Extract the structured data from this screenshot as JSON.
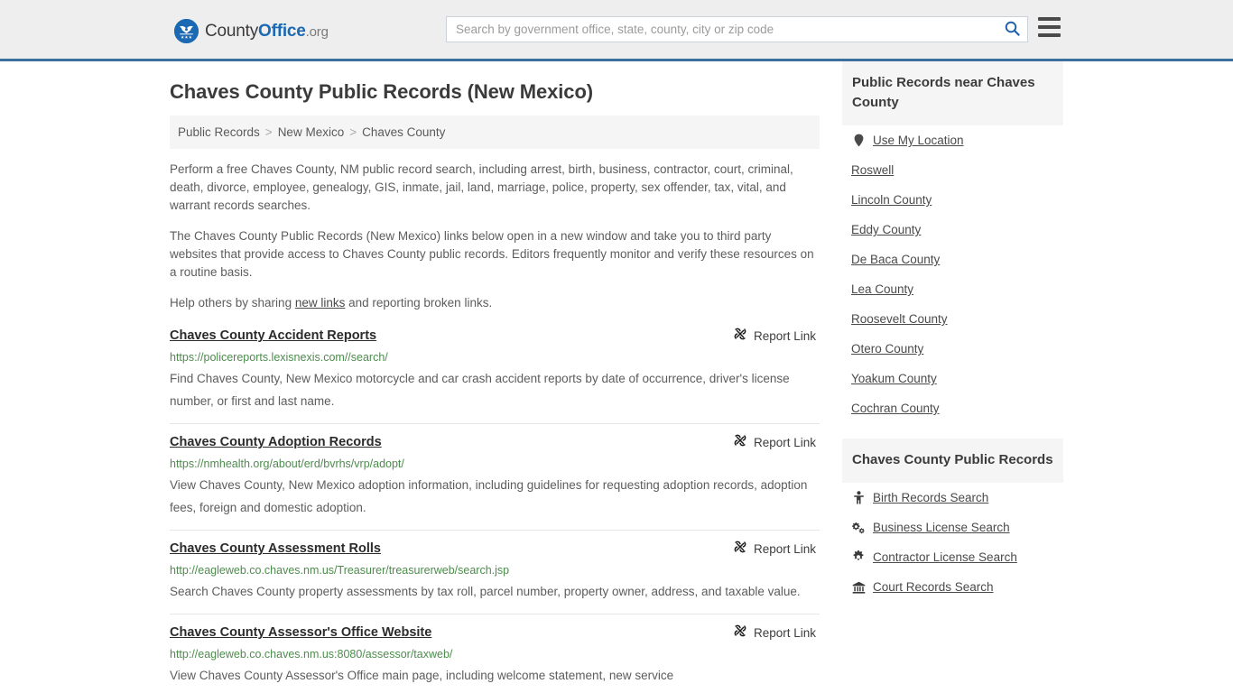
{
  "header": {
    "logo": {
      "icon": "county-office-eagle-emblem",
      "part1": "County",
      "part2": "Office",
      "part3": ".org"
    },
    "search": {
      "placeholder": "Search by government office, state, county, city or zip code",
      "value": "",
      "search_icon": "search-icon"
    },
    "menu_icon": "hamburger-menu-icon"
  },
  "main": {
    "title": "Chaves County Public Records (New Mexico)",
    "breadcrumb": {
      "items": [
        "Public Records",
        "New Mexico",
        "Chaves County"
      ],
      "separator": ">"
    },
    "intro": {
      "p1": "Perform a free Chaves County, NM public record search, including arrest, birth, business, contractor, court, criminal, death, divorce, employee, genealogy, GIS, inmate, jail, land, marriage, police, property, sex offender, tax, vital, and warrant records searches.",
      "p2": "The Chaves County Public Records (New Mexico) links below open in a new window and take you to third party websites that provide access to Chaves County public records. Editors frequently monitor and verify these resources on a routine basis.",
      "p3_before": "Help others by sharing ",
      "p3_link": "new links",
      "p3_after": " and reporting broken links."
    },
    "report_link_label": "Report Link",
    "report_link_icon": "broken-link-icon",
    "results": [
      {
        "title": "Chaves County Accident Reports",
        "url": "https://policereports.lexisnexis.com//search/",
        "description": "Find Chaves County, New Mexico motorcycle and car crash accident reports by date of occurrence, driver's license number, or first and last name."
      },
      {
        "title": "Chaves County Adoption Records",
        "url": "https://nmhealth.org/about/erd/bvrhs/vrp/adopt/",
        "description": "View Chaves County, New Mexico adoption information, including guidelines for requesting adoption records, adoption fees, foreign and domestic adoption."
      },
      {
        "title": "Chaves County Assessment Rolls",
        "url": "http://eagleweb.co.chaves.nm.us/Treasurer/treasurerweb/search.jsp",
        "description": "Search Chaves County property assessments by tax roll, parcel number, property owner, address, and taxable value."
      },
      {
        "title": "Chaves County Assessor's Office Website",
        "url": "http://eagleweb.co.chaves.nm.us:8080/assessor/taxweb/",
        "description": "View Chaves County Assessor's Office main page, including welcome statement, new service"
      }
    ]
  },
  "sidebar": {
    "nearby": {
      "heading": "Public Records near Chaves County",
      "items": [
        {
          "label": "Use My Location",
          "icon": "map-pin-icon"
        },
        {
          "label": "Roswell",
          "icon": ""
        },
        {
          "label": "Lincoln County",
          "icon": ""
        },
        {
          "label": "Eddy County",
          "icon": ""
        },
        {
          "label": "De Baca County",
          "icon": ""
        },
        {
          "label": "Lea County",
          "icon": ""
        },
        {
          "label": "Roosevelt County",
          "icon": ""
        },
        {
          "label": "Otero County",
          "icon": ""
        },
        {
          "label": "Yoakum County",
          "icon": ""
        },
        {
          "label": "Cochran County",
          "icon": ""
        }
      ]
    },
    "records": {
      "heading": "Chaves County Public Records",
      "items": [
        {
          "label": "Birth Records Search",
          "icon": "baby-icon"
        },
        {
          "label": "Business License Search",
          "icon": "cogs-icon"
        },
        {
          "label": "Contractor License Search",
          "icon": "cog-icon"
        },
        {
          "label": "Court Records Search",
          "icon": "courthouse-icon"
        }
      ]
    }
  },
  "colors": {
    "brand_blue": "#1b68b3",
    "header_rule": "#3b6f9e",
    "url_green": "#4e8c4e",
    "panel_gray": "#f5f5f5"
  }
}
